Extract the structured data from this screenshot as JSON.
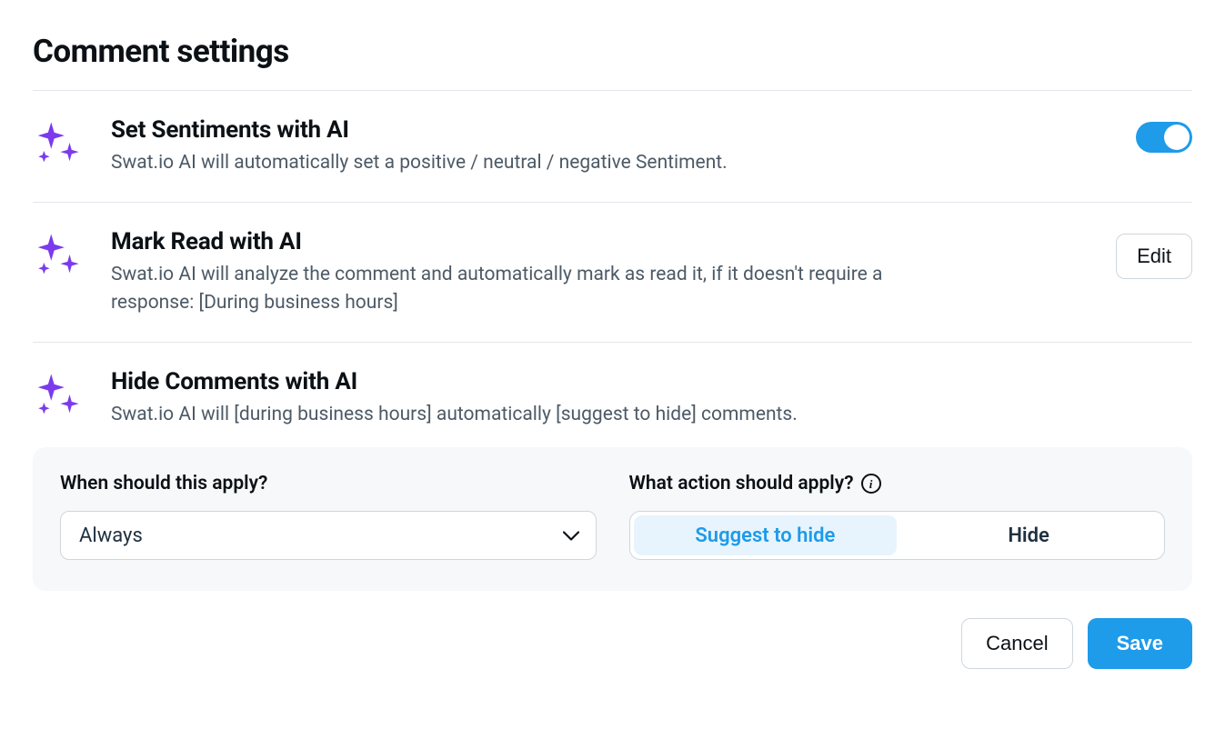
{
  "page": {
    "title": "Comment settings"
  },
  "settings": {
    "sentiments": {
      "title": "Set Sentiments with AI",
      "description": "Swat.io AI will automatically set a positive / neutral / negative Sentiment.",
      "toggle_on": true
    },
    "mark_read": {
      "title": "Mark Read with AI",
      "description": "Swat.io AI will analyze the comment and automatically mark as read it, if it doesn't require a response: [During business hours]",
      "edit_label": "Edit"
    },
    "hide_comments": {
      "title": "Hide Comments with AI",
      "description": "Swat.io AI will [during business hours] automatically [suggest to hide] comments.",
      "config": {
        "when_label": "When should this apply?",
        "when_value": "Always",
        "action_label": "What action should apply?",
        "action_options": {
          "suggest": "Suggest to hide",
          "hide": "Hide"
        },
        "action_selected": "suggest"
      }
    }
  },
  "footer": {
    "cancel": "Cancel",
    "save": "Save"
  },
  "colors": {
    "accent": "#1e9be9",
    "sparkle": "#7c3aed",
    "text_secondary": "#4d5a66",
    "border": "#cfd6dc"
  }
}
